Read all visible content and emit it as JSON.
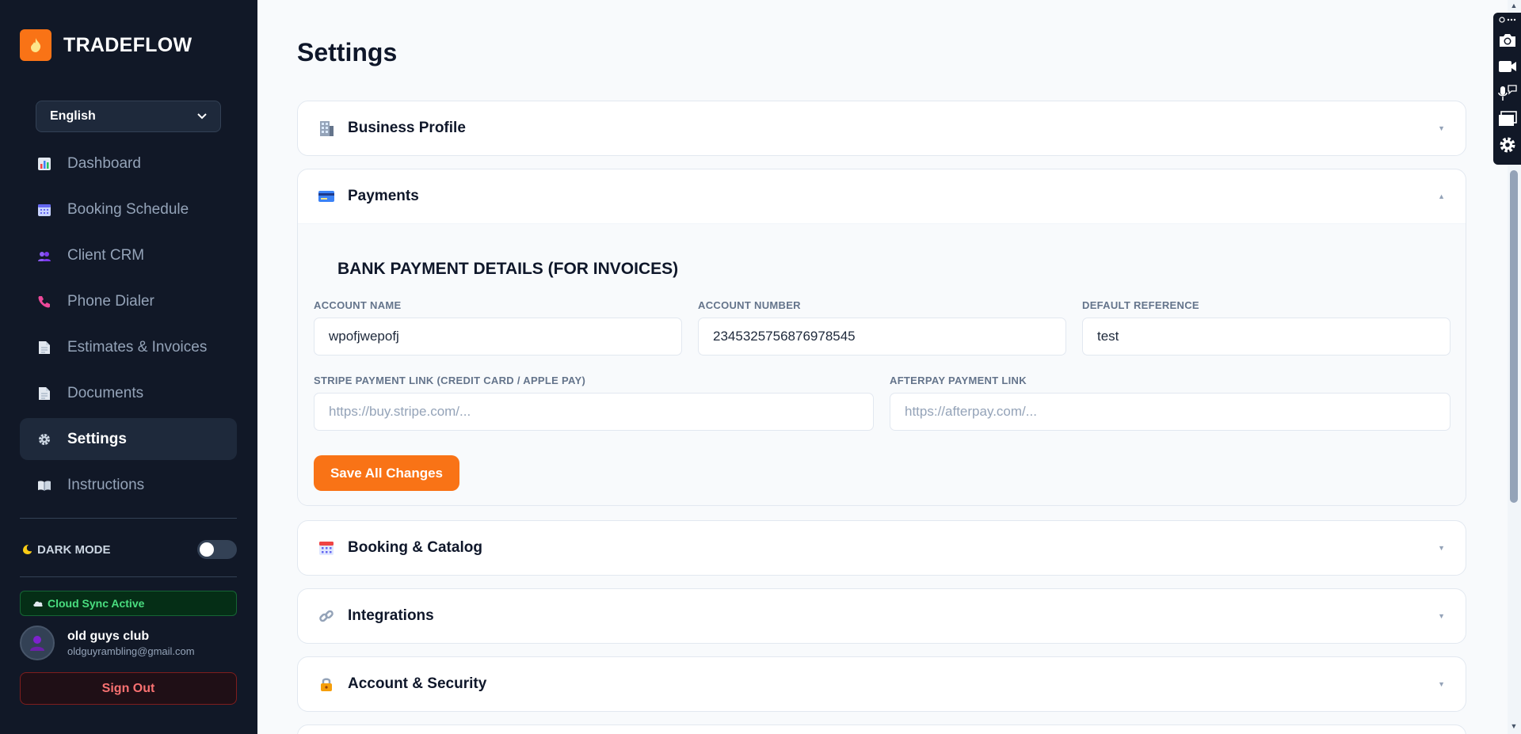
{
  "app": {
    "name": "TRADEFLOW"
  },
  "language": {
    "selected": "English"
  },
  "nav": [
    {
      "label": "Dashboard",
      "icon": "chart-icon",
      "active": false
    },
    {
      "label": "Booking Schedule",
      "icon": "calendar-icon",
      "active": false
    },
    {
      "label": "Client CRM",
      "icon": "users-icon",
      "active": false
    },
    {
      "label": "Phone Dialer",
      "icon": "phone-icon",
      "active": false
    },
    {
      "label": "Estimates & Invoices",
      "icon": "document-icon",
      "active": false
    },
    {
      "label": "Documents",
      "icon": "document-icon",
      "active": false
    },
    {
      "label": "Settings",
      "icon": "gear-icon",
      "active": true
    },
    {
      "label": "Instructions",
      "icon": "book-icon",
      "active": false
    }
  ],
  "dark_mode": {
    "label": "DARK MODE",
    "enabled": false
  },
  "sync": {
    "label": "Cloud Sync Active"
  },
  "user": {
    "name": "old guys club",
    "email": "oldguyrambling@gmail.com"
  },
  "signout": {
    "label": "Sign Out"
  },
  "page": {
    "title": "Settings"
  },
  "sections": {
    "business_profile": {
      "title": "Business Profile"
    },
    "payments": {
      "title": "Payments"
    },
    "booking_catalog": {
      "title": "Booking & Catalog"
    },
    "integrations": {
      "title": "Integrations"
    },
    "account_security": {
      "title": "Account & Security"
    }
  },
  "payments_form": {
    "heading": "BANK PAYMENT DETAILS (FOR INVOICES)",
    "account_name": {
      "label": "ACCOUNT NAME",
      "value": "wpofjwepofj"
    },
    "account_number": {
      "label": "ACCOUNT NUMBER",
      "value": "2345325756876978545"
    },
    "default_reference": {
      "label": "DEFAULT REFERENCE",
      "value": "test"
    },
    "stripe_link": {
      "label": "STRIPE PAYMENT LINK (CREDIT CARD / APPLE PAY)",
      "placeholder": "https://buy.stripe.com/..."
    },
    "afterpay_link": {
      "label": "AFTERPAY PAYMENT LINK",
      "placeholder": "https://afterpay.com/..."
    },
    "save_label": "Save All Changes"
  },
  "colors": {
    "accent": "#f97316",
    "sidebar": "#111827",
    "success": "#4ade80",
    "danger": "#f87171"
  }
}
